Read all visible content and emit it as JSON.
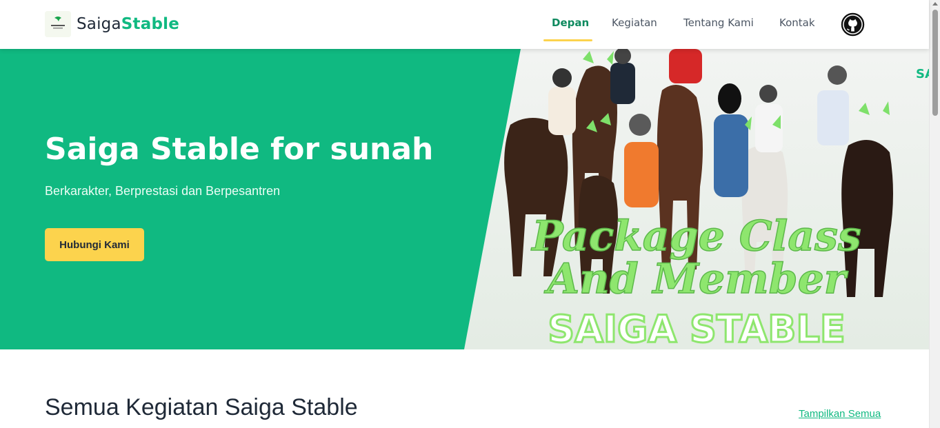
{
  "header": {
    "brand_prefix": "Saiga",
    "brand_accent": "Stable",
    "nav": [
      {
        "label": "Depan",
        "active": true
      },
      {
        "label": "Kegiatan",
        "active": false
      },
      {
        "label": "Tentang Kami",
        "active": false
      },
      {
        "label": "Kontak",
        "active": false
      }
    ],
    "github_icon": "github-icon"
  },
  "hero": {
    "title": "Saiga Stable for sunah",
    "subtitle": "Berkarakter, Berprestasi dan Berpesantren",
    "button_label": "Hubungi Kami",
    "image_text_line1": "Package Class",
    "image_text_line2": "And Member",
    "image_text_line3": "SAIGA STABLE",
    "image_corner_text": "SA"
  },
  "section": {
    "title": "Semua Kegiatan Saiga Stable",
    "link_label": "Tampilkan Semua"
  },
  "colors": {
    "primary_green": "#10b981",
    "accent_yellow": "#fcd34d",
    "neon_green": "#7ee06a"
  }
}
